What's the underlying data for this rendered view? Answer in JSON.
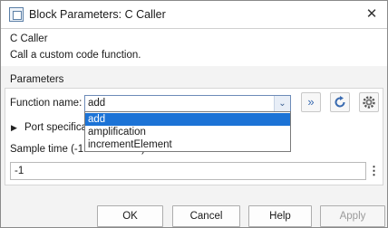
{
  "window": {
    "title": "Block Parameters: C Caller"
  },
  "header": {
    "block_name": "C Caller",
    "description": "Call a custom code function."
  },
  "parameters": {
    "section_label": "Parameters",
    "function_name": {
      "label": "Function name:",
      "value": "add",
      "options": [
        "add",
        "amplification",
        "incrementElement"
      ],
      "selected_option": "add"
    },
    "port_specification_label": "Port specification",
    "sample_time": {
      "label": "Sample time (-1 for inherited):",
      "value": "-1"
    }
  },
  "icons": {
    "refresh_ports": "double-chevron-right-icon",
    "reload": "refresh-icon",
    "settings": "gear-icon",
    "kebab": "more-vertical-icon"
  },
  "buttons": {
    "ok": "OK",
    "cancel": "Cancel",
    "help": "Help",
    "apply": "Apply"
  },
  "colors": {
    "selection": "#1c73d6",
    "accent": "#3a6bb0"
  }
}
